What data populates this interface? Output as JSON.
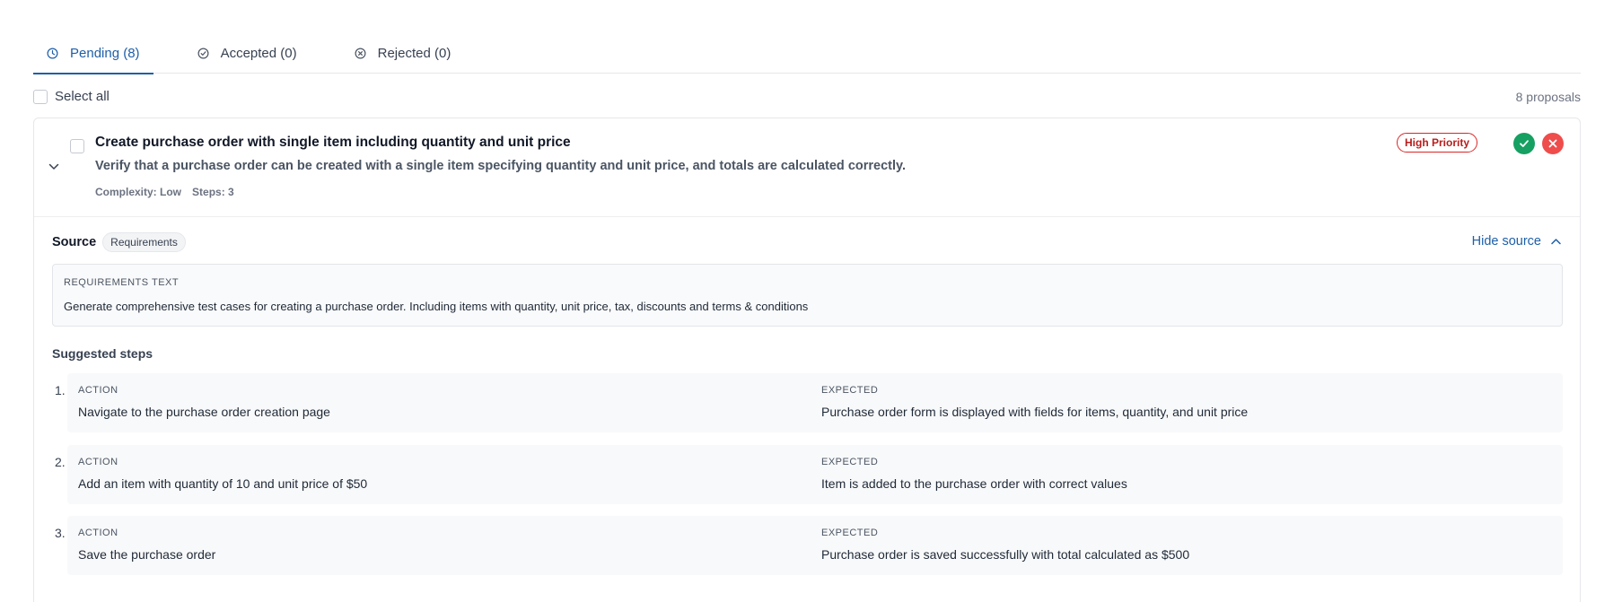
{
  "tabs": [
    {
      "label": "Pending (8)",
      "icon": "clock-icon",
      "active": true
    },
    {
      "label": "Accepted (0)",
      "icon": "check-circle-icon",
      "active": false
    },
    {
      "label": "Rejected (0)",
      "icon": "x-circle-icon",
      "active": false
    }
  ],
  "select_all_label": "Select all",
  "proposal_count": "8 proposals",
  "colors": {
    "accent": "#1e5fa8",
    "accept": "#16a061",
    "reject": "#ef4c4c",
    "priority": "#dc2626"
  },
  "proposal": {
    "title": "Create purchase order with single item including quantity and unit price",
    "description": "Verify that a purchase order can be created with a single item specifying quantity and unit price, and totals are calculated correctly.",
    "complexity": "Complexity: Low",
    "steps_count": "Steps: 3",
    "priority": "High Priority",
    "source_label": "Source",
    "source_type": "Requirements",
    "hide_source_label": "Hide source",
    "requirements_label": "REQUIREMENTS TEXT",
    "requirements_text": "Generate comprehensive test cases for creating a purchase order. Including items with quantity, unit price, tax, discounts and terms & conditions",
    "steps_title": "Suggested steps",
    "action_label": "ACTION",
    "expected_label": "EXPECTED",
    "steps": [
      {
        "num": "1.",
        "action": "Navigate to the purchase order creation page",
        "expected": "Purchase order form is displayed with fields for items, quantity, and unit price"
      },
      {
        "num": "2.",
        "action": "Add an item with quantity of 10 and unit price of $50",
        "expected": "Item is added to the purchase order with correct values"
      },
      {
        "num": "3.",
        "action": "Save the purchase order",
        "expected": "Purchase order is saved successfully with total calculated as $500"
      }
    ]
  }
}
